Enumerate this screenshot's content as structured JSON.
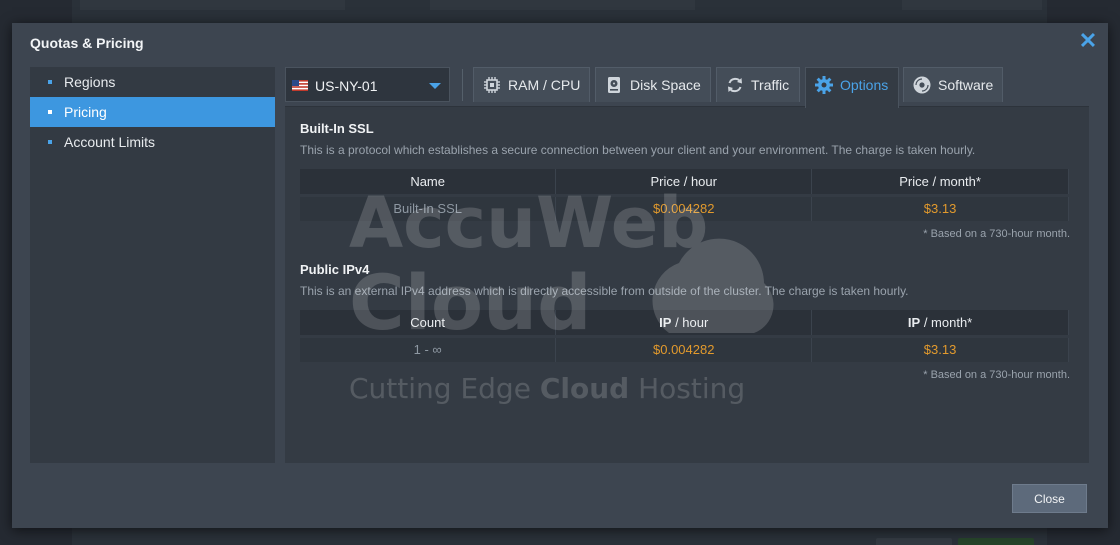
{
  "dialog": {
    "title": "Quotas & Pricing"
  },
  "nav": {
    "items": [
      {
        "label": "Regions"
      },
      {
        "label": "Pricing"
      },
      {
        "label": "Account Limits"
      }
    ]
  },
  "region": {
    "label": "US-NY-01"
  },
  "tabs": [
    {
      "label": "RAM / CPU",
      "icon": "cpu-chip-icon"
    },
    {
      "label": "Disk Space",
      "icon": "hard-drive-icon"
    },
    {
      "label": "Traffic",
      "icon": "refresh-icon"
    },
    {
      "label": "Options",
      "icon": "gear-icon"
    },
    {
      "label": "Software",
      "icon": "disc-icon"
    }
  ],
  "ssl": {
    "title": "Built-In SSL",
    "description": "This is a protocol which establishes a secure connection between your client and your environment. The charge is taken hourly.",
    "columns": [
      "Name",
      "Price / hour",
      "Price / month*"
    ],
    "row": {
      "name": "Built-In SSL",
      "hour": "$0.004282",
      "month": "$3.13"
    },
    "footnote": "* Based on a 730-hour month."
  },
  "ipv4": {
    "title": "Public IPv4",
    "description": "This is an external IPv4 address which is directly accessible from outside of the cluster. The charge is taken hourly.",
    "columns": {
      "count": "Count",
      "hour_bold": "IP",
      "hour_rest": " / hour",
      "month_bold": "IP",
      "month_rest": " / month*"
    },
    "row": {
      "count": "1 - ∞",
      "hour": "$0.004282",
      "month": "$3.13"
    },
    "footnote": "* Based on a 730-hour month."
  },
  "watermark": {
    "line1": "AccuWeb",
    "line2": "Cloud",
    "tagline_a": "Cutting Edge ",
    "tagline_b": "Cloud",
    "tagline_c": " Hosting"
  },
  "footer": {
    "close_label": "Close"
  },
  "colors": {
    "accent": "#4aa3e8",
    "active_nav": "#3d97e0",
    "price": "#e29a2d"
  }
}
